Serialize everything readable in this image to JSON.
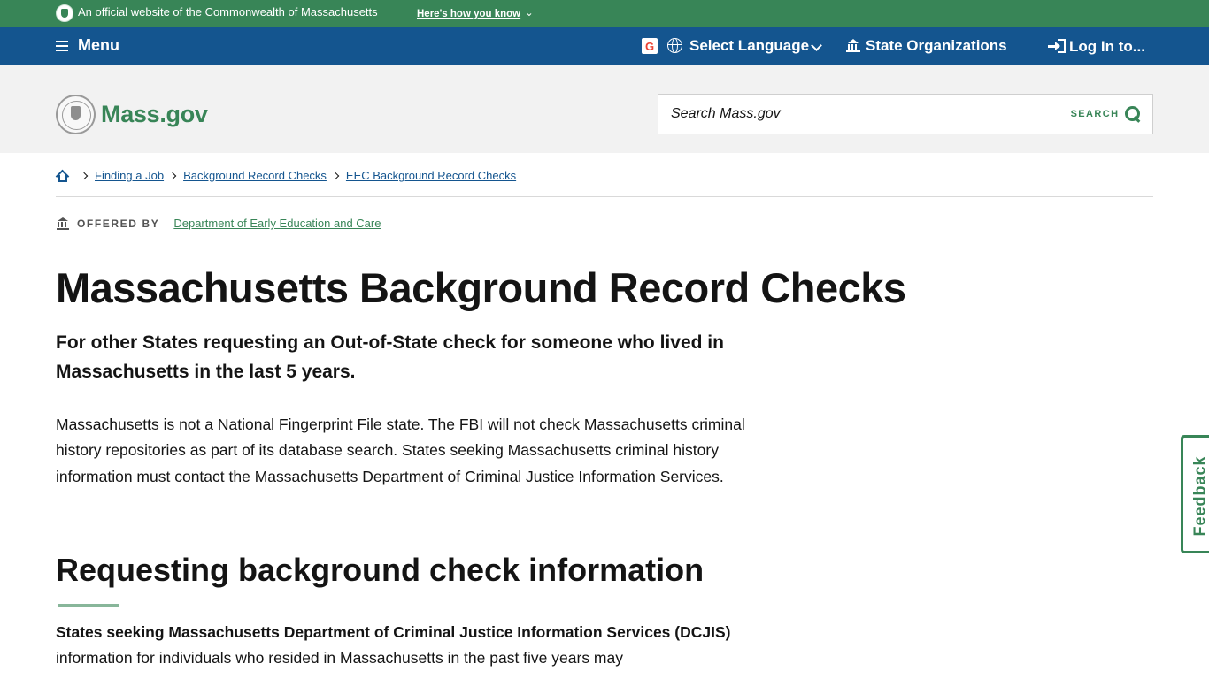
{
  "official_banner": {
    "text": "An official website of the Commonwealth of Massachusetts",
    "how_know": "Here's how you know",
    "bg_color": "#388557"
  },
  "utility_nav": {
    "menu_label": "Menu",
    "language_label": "Select Language",
    "state_orgs_label": "State Organizations",
    "login_label": "Log In to...",
    "bg_color": "#14558f"
  },
  "header": {
    "logo_text": "Mass.gov",
    "search_placeholder": "Search Mass.gov",
    "search_button_label": "SEARCH"
  },
  "breadcrumb": {
    "items": [
      {
        "label": "Finding a Job"
      },
      {
        "label": "Background Record Checks"
      },
      {
        "label": "EEC Background Record Checks"
      }
    ]
  },
  "offered_by": {
    "label": "OFFERED BY",
    "organization": "Department of Early Education and Care"
  },
  "main": {
    "title": "Massachusetts Background Record Checks",
    "subtitle": "For other States requesting an Out-of-State check for someone who lived in Massachusetts in the last 5 years.",
    "intro": "Massachusetts is not a National Fingerprint File state. The FBI will not check Massachusetts criminal history repositories as part of its database search. States seeking Massachusetts criminal history information must contact the Massachusetts Department of Criminal Justice Information Services.",
    "section_heading": "Requesting background check information",
    "section_body_bold": "States seeking Massachusetts Department of Criminal Justice Information Services (DCJIS)",
    "section_body_rest": " information for individuals who resided in Massachusetts in the past five years may"
  },
  "feedback": {
    "label": "Feedback"
  },
  "colors": {
    "brand_green": "#388557",
    "brand_blue": "#14558f",
    "header_grey": "#f2f2f2"
  }
}
